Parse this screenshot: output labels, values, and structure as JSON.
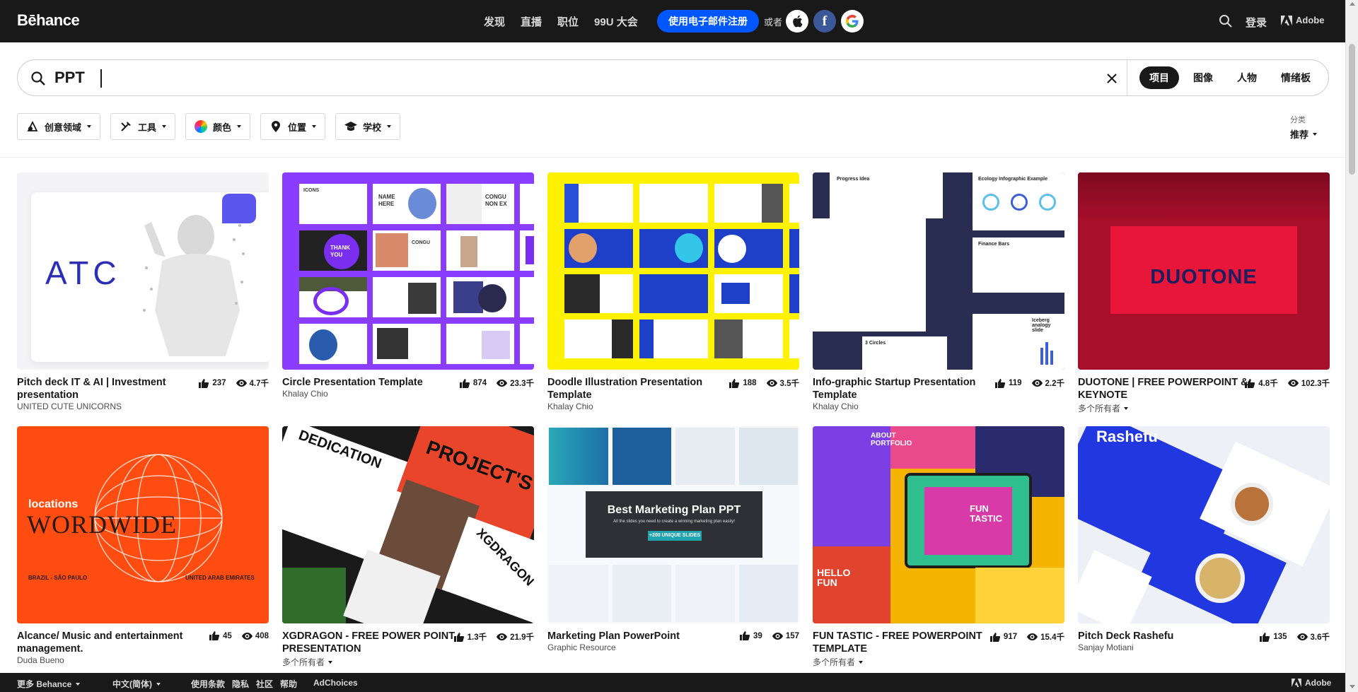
{
  "header": {
    "logo": "Bēhance",
    "nav": [
      "发现",
      "直播",
      "职位",
      "99U 大会"
    ],
    "signup_label": "使用电子邮件注册",
    "or_text": "或者",
    "social": [
      "apple-icon",
      "facebook-icon",
      "google-icon"
    ],
    "login_label": "登录",
    "adobe_label": "Adobe"
  },
  "search": {
    "value": "PPT",
    "tabs": [
      "项目",
      "图像",
      "人物",
      "情绪板"
    ],
    "active_tab": "项目"
  },
  "filters": [
    "创意领域",
    "工具",
    "颜色",
    "位置",
    "学校"
  ],
  "sort": {
    "label": "分类",
    "value": "推荐"
  },
  "projects": [
    {
      "title": "Pitch deck IT & AI | Investment presentation",
      "owner": "UNITED CUTE UNICORNS",
      "likes": "237",
      "views": "4.7千",
      "multi_owner": false
    },
    {
      "title": "Circle Presentation Template",
      "owner": "Khalay Chio",
      "likes": "874",
      "views": "23.3千",
      "multi_owner": false
    },
    {
      "title": "Doodle Illustration Presentation Template",
      "owner": "Khalay Chio",
      "likes": "188",
      "views": "3.5千",
      "multi_owner": false
    },
    {
      "title": "Info-graphic Startup Presentation Template",
      "owner": "Khalay Chio",
      "likes": "119",
      "views": "2.2千",
      "multi_owner": false
    },
    {
      "title": "DUOTONE | FREE POWERPOINT & KEYNOTE",
      "owner": "多个所有者",
      "likes": "4.8千",
      "views": "102.3千",
      "multi_owner": true
    },
    {
      "title": "Alcance/ Music and entertainment management.",
      "owner": "Duda Bueno",
      "likes": "45",
      "views": "408",
      "multi_owner": false
    },
    {
      "title": "XGDRAGON - FREE POWER POINT PRESENTATION",
      "owner": "多个所有者",
      "likes": "1.3千",
      "views": "21.9千",
      "multi_owner": true
    },
    {
      "title": "Marketing Plan PowerPoint",
      "owner": "Graphic Resource",
      "likes": "39",
      "views": "157",
      "multi_owner": false
    },
    {
      "title": "FUN TASTIC - FREE POWERPOINT TEMPLATE",
      "owner": "多个所有者",
      "likes": "917",
      "views": "15.4千",
      "multi_owner": true
    },
    {
      "title": "Pitch Deck Rashefu",
      "owner": "Sanjay Motiani",
      "likes": "135",
      "views": "3.6千",
      "multi_owner": false
    }
  ],
  "thumb_text": {
    "atc": "ATC",
    "duotone": "DUOTONE",
    "locations": "locations",
    "wordwide": "WORDWIDE",
    "brazil": "BRAZIL - SÃO PAULO",
    "uae": "UNITED ARAB EMIRATES",
    "marketing": "Best Marketing Plan PPT",
    "marketing_sub": "All the slides you need to create a winning marketing plan easily!",
    "marketing_badge": "+200 UNIQUE SLIDES",
    "funtastic": "FUN TASTIC",
    "hello_fun": "HELLO FUN",
    "about": "ABOUT PORTFOLIO",
    "rashefu": "Rashefu",
    "xg_dedication": "DEDICATION",
    "xg_project": "PROJECT'S",
    "xg_name": "XGDRAGON",
    "info_progress": "Progress Idea",
    "info_eco": "Ecology Infographic Example",
    "info_finance": "Finance Bars",
    "info_circles": "3 Circles",
    "info_iceberg": "Iceberg analogy slide",
    "circle_thank": "THANK YOU",
    "circle_name": "NAME HERE",
    "circle_congu": "CONGU NON EX"
  },
  "footer": {
    "more": "更多 Behance",
    "lang": "中文(简体)",
    "links": [
      "使用条款",
      "隐私",
      "社区",
      "帮助"
    ],
    "adchoices": "AdChoices",
    "adobe": "Adobe"
  },
  "colors": {
    "brand_blue": "#0057ff",
    "topbar": "#191919",
    "duotone_red": "#c8102e",
    "circle_purple": "#8b3dff",
    "doodle_yellow": "#fff200",
    "alcance_orange": "#ff4d12"
  }
}
